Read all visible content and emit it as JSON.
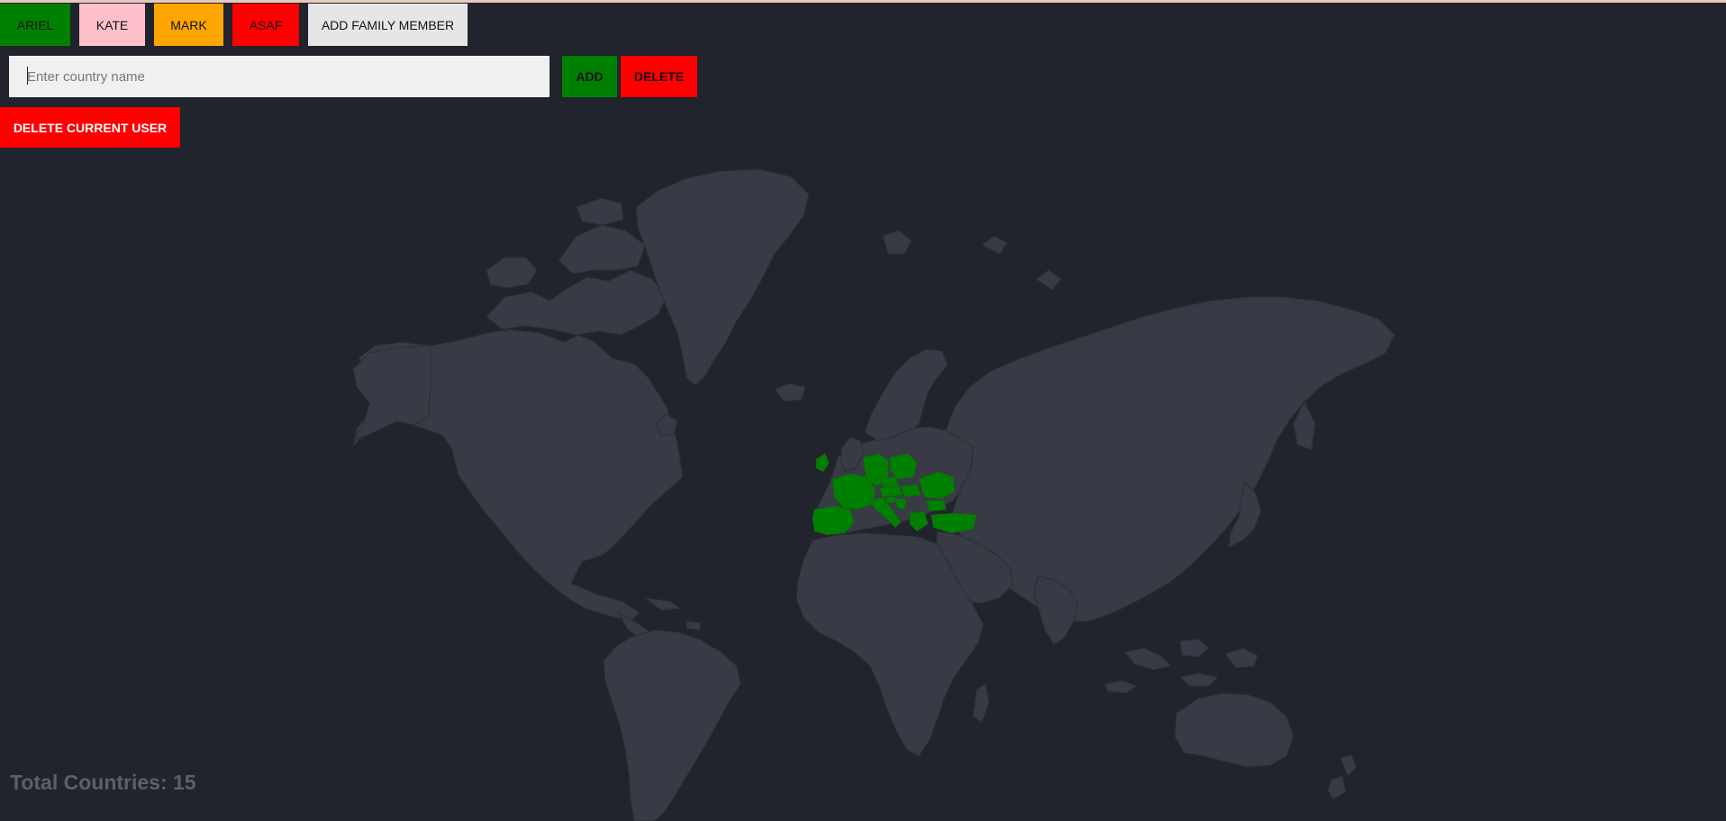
{
  "family_tabs": [
    {
      "label": "ARIEL",
      "color": "#008000"
    },
    {
      "label": "KATE",
      "color": "#ffc0cb"
    },
    {
      "label": "MARK",
      "color": "#ffa500"
    },
    {
      "label": "ASAF",
      "color": "#ff0000"
    }
  ],
  "add_member": {
    "label": "ADD FAMILY MEMBER",
    "color": "#e6e6e6"
  },
  "country_input": {
    "placeholder": "Enter country name",
    "value": ""
  },
  "add_button": {
    "label": "ADD",
    "color": "#008000"
  },
  "delete_button": {
    "label": "DELETE",
    "color": "#ff0000"
  },
  "delete_user_button": {
    "label": "DELETE CURRENT USER",
    "color": "#ff0000"
  },
  "map": {
    "land_color": "#383a45",
    "border_color": "#2a2c36",
    "visited_color": "#008000",
    "visited_countries": [
      "Ireland",
      "France",
      "Spain",
      "Germany",
      "Czechia",
      "Austria",
      "Italy",
      "Slovenia",
      "Croatia",
      "Hungary",
      "Romania",
      "Bulgaria",
      "Greece",
      "Turkey",
      "Poland"
    ]
  },
  "total": {
    "text": "Total Countries: 15"
  }
}
